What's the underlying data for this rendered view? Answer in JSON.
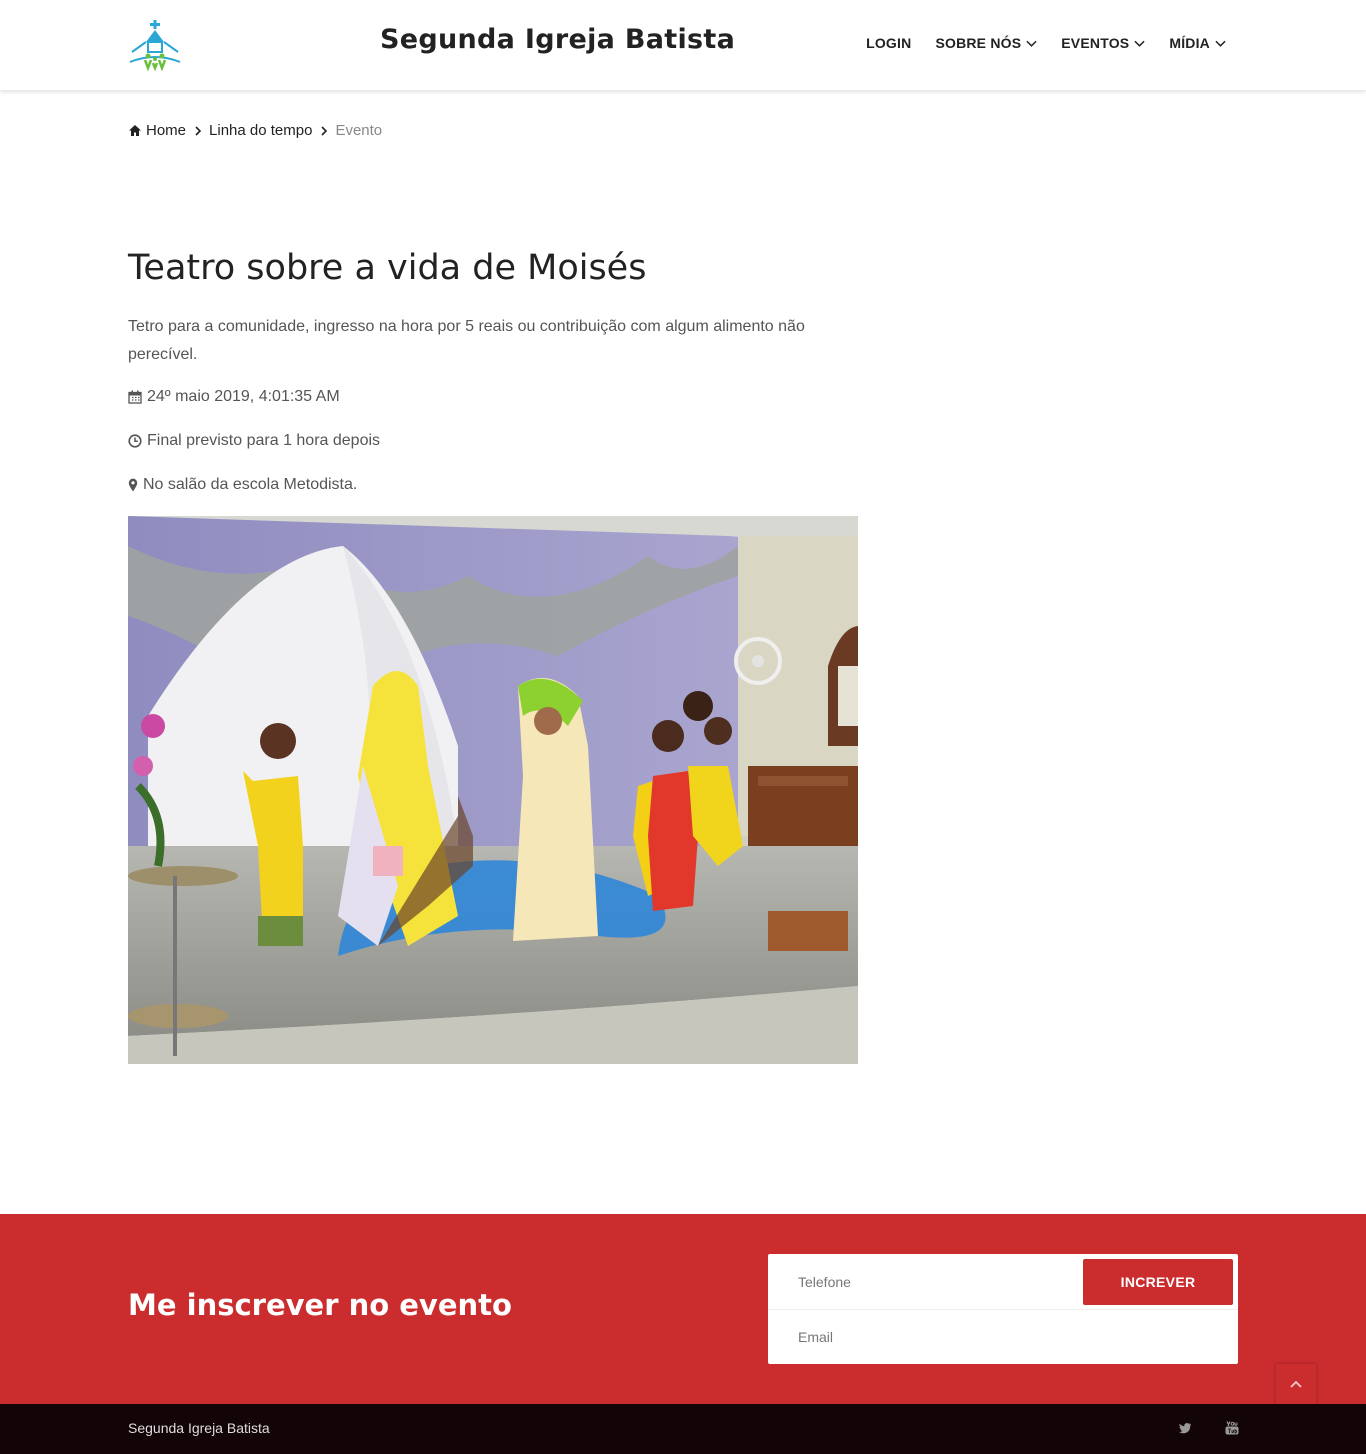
{
  "header": {
    "title": "Segunda Igreja Batista",
    "nav": {
      "login": "LOGIN",
      "about": "SOBRE NÓS",
      "events": "EVENTOS",
      "media": "MÍDIA"
    }
  },
  "breadcrumb": {
    "home": "Home",
    "timeline": "Linha do tempo",
    "current": "Evento"
  },
  "event": {
    "title": "Teatro sobre a vida de Moisés",
    "description": "Tetro para a comunidade, ingresso na hora por 5 reais ou contribuição com algum alimento não perecível.",
    "date": "24º maio 2019, 4:01:35 AM",
    "end": "Final previsto para 1 hora depois",
    "location": "No salão da escola Metodista."
  },
  "subscribe": {
    "title": "Me inscrever no evento",
    "phone_placeholder": "Telefone",
    "email_placeholder": "Email",
    "button": "INCREVER"
  },
  "footer": {
    "text": "Segunda Igreja Batista",
    "social": [
      "twitter-icon",
      "youtube-icon"
    ]
  },
  "colors": {
    "accent": "#cb2d2f",
    "footer": "#130507"
  }
}
